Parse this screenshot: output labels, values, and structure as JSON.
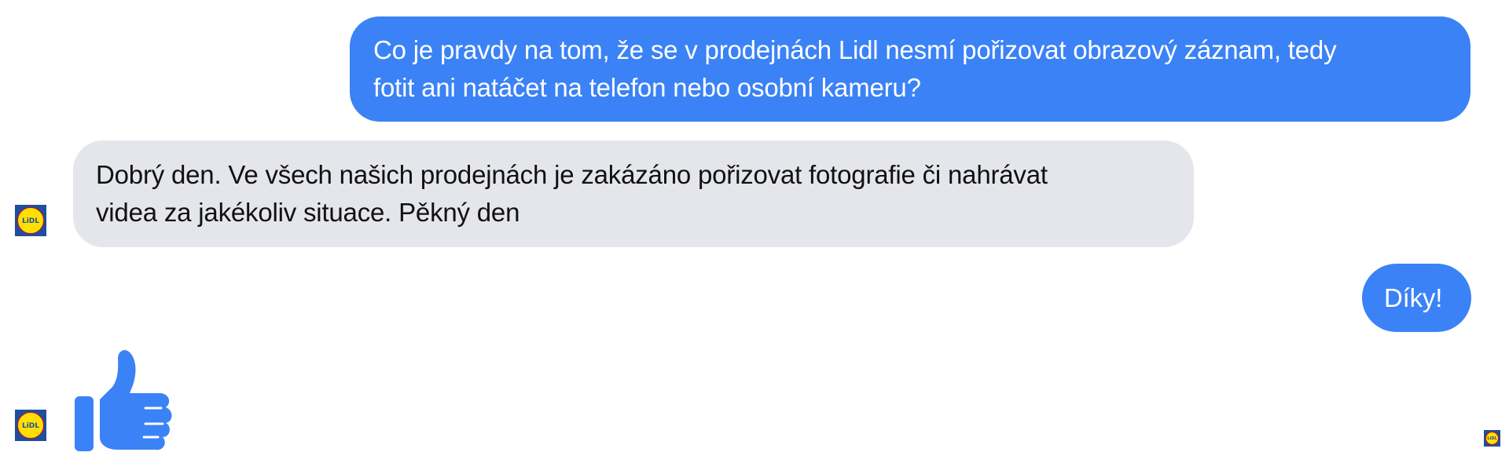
{
  "conversation": {
    "messages": [
      {
        "sender": "user",
        "lines": [
          "Co je pravdy na tom, že se v prodejnách Lidl nesmí pořizovat obrazový záznam, tedy",
          "fotit ani natáčet na telefon nebo osobní kameru?"
        ]
      },
      {
        "sender": "page",
        "lines": [
          "Dobrý den. Ve všech našich prodejnách je zakázáno pořizovat fotografie či nahrávat",
          "videa za jakékoliv situace. Pěkný den"
        ]
      },
      {
        "sender": "user",
        "lines": [
          "Díky!"
        ]
      },
      {
        "sender": "page",
        "reaction": "thumbs-up"
      }
    ],
    "avatar_label": "LiDL"
  },
  "colors": {
    "outgoing_bubble": "#3b82f6",
    "incoming_bubble": "#e5e6eb",
    "like": "#3b82f6",
    "lidl_blue": "#1f4e9c",
    "lidl_yellow": "#ffe000",
    "lidl_red": "#e10a0a"
  }
}
